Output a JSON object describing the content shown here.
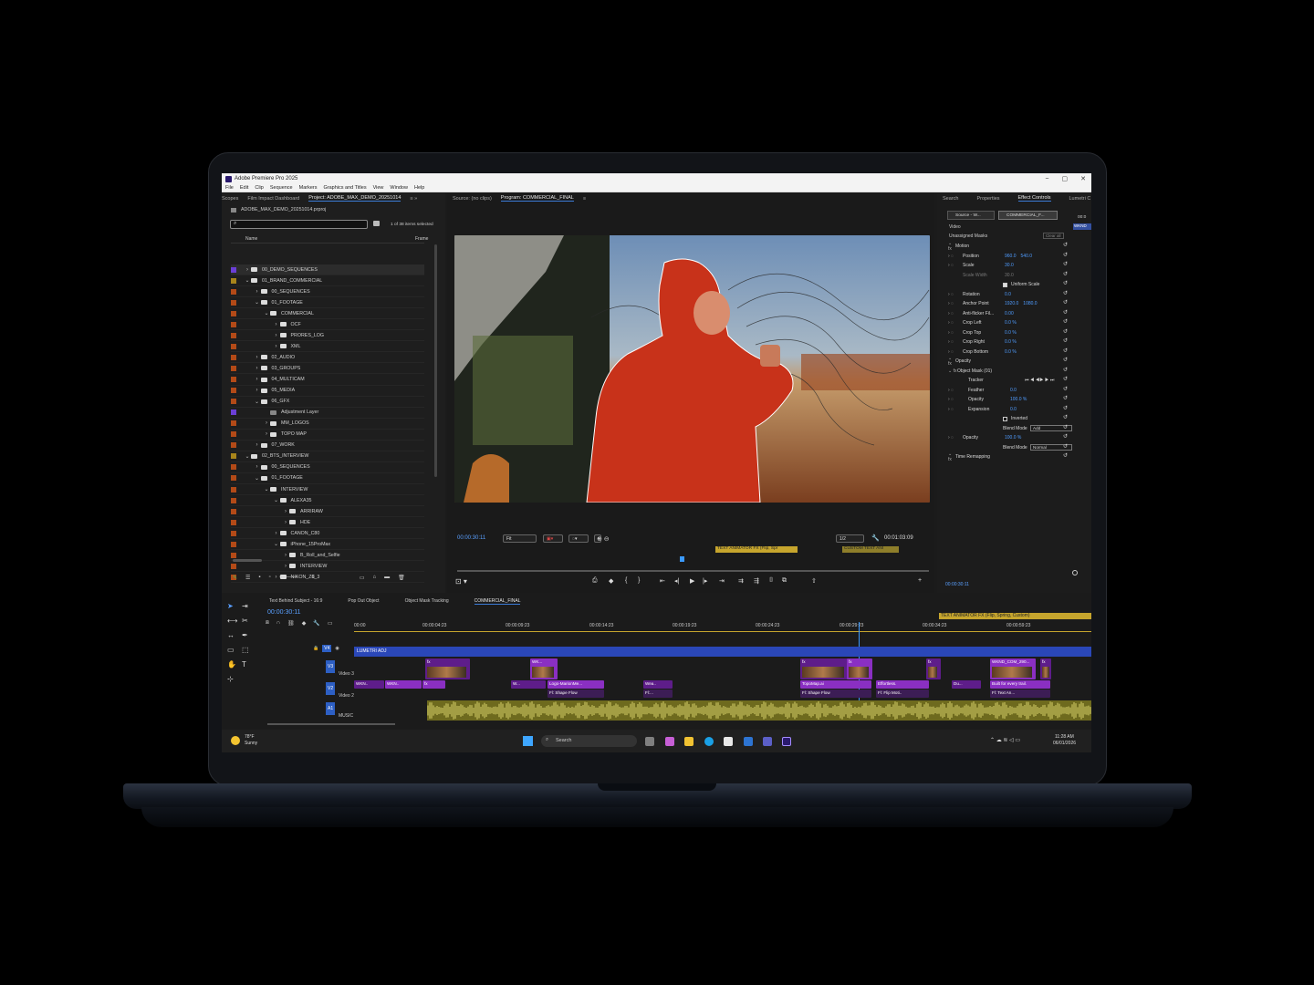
{
  "window": {
    "title": "Adobe Premiere Pro 2025",
    "minimize": "−",
    "maximize": "▢",
    "close": "✕"
  },
  "menu": [
    "File",
    "Edit",
    "Clip",
    "Sequence",
    "Markers",
    "Graphics and Titles",
    "View",
    "Window",
    "Help"
  ],
  "left_tabs": {
    "t1": "Scopes",
    "t2": "Film Impact Dashboard",
    "t3": "Project: ADOBE_MAX_DEMO_20251014"
  },
  "project": {
    "file": "ADOBE_MAX_DEMO_20251014.prproj",
    "search_placeholder": "",
    "selected": "1 of 38 items selected",
    "col_name": "Name",
    "col_frame": "Frame",
    "items": [
      {
        "name": "00_DEMO_SEQUENCES",
        "indent": 1,
        "open": false,
        "color": "#6b3fd6"
      },
      {
        "name": "01_BRAND_COMMERCIAL",
        "indent": 1,
        "open": true,
        "color": "#a8851b"
      },
      {
        "name": "00_SEQUENCES",
        "indent": 2,
        "open": false,
        "color": "#b34a17"
      },
      {
        "name": "01_FOOTAGE",
        "indent": 2,
        "open": true,
        "color": "#b34a17"
      },
      {
        "name": "COMMERCIAL",
        "indent": 3,
        "open": true,
        "color": "#b34a17"
      },
      {
        "name": "OCF",
        "indent": 4,
        "open": false,
        "color": "#b34a17"
      },
      {
        "name": "PRORES_LOG",
        "indent": 4,
        "open": false,
        "color": "#b34a17"
      },
      {
        "name": "XML",
        "indent": 4,
        "open": false,
        "color": "#b34a17"
      },
      {
        "name": "02_AUDIO",
        "indent": 2,
        "open": false,
        "color": "#b34a17"
      },
      {
        "name": "03_GROUPS",
        "indent": 2,
        "open": false,
        "color": "#b34a17"
      },
      {
        "name": "04_MULTICAM",
        "indent": 2,
        "open": false,
        "color": "#b34a17"
      },
      {
        "name": "05_MEDIA",
        "indent": 2,
        "open": false,
        "color": "#b34a17"
      },
      {
        "name": "06_GFX",
        "indent": 2,
        "open": true,
        "color": "#b34a17"
      },
      {
        "name": "Adjustment Layer",
        "indent": 3,
        "open": null,
        "color": "#6b3fd6"
      },
      {
        "name": "MM_LOGOS",
        "indent": 3,
        "open": false,
        "color": "#b34a17"
      },
      {
        "name": "TOPO MAP",
        "indent": 3,
        "open": false,
        "color": "#b34a17"
      },
      {
        "name": "07_WORK",
        "indent": 2,
        "open": false,
        "color": "#b34a17"
      },
      {
        "name": "02_BTS_INTERVIEW",
        "indent": 1,
        "open": true,
        "color": "#a8851b"
      },
      {
        "name": "00_SEQUENCES",
        "indent": 2,
        "open": false,
        "color": "#b34a17"
      },
      {
        "name": "01_FOOTAGE",
        "indent": 2,
        "open": true,
        "color": "#b34a17"
      },
      {
        "name": "INTERVIEW",
        "indent": 3,
        "open": true,
        "color": "#b34a17"
      },
      {
        "name": "ALEXA35",
        "indent": 4,
        "open": true,
        "color": "#b34a17"
      },
      {
        "name": "ARRIRAW",
        "indent": 5,
        "open": false,
        "color": "#b34a17"
      },
      {
        "name": "HDE",
        "indent": 5,
        "open": false,
        "color": "#b34a17"
      },
      {
        "name": "CANON_C80",
        "indent": 4,
        "open": false,
        "color": "#b34a17"
      },
      {
        "name": "iPhone_15ProMax",
        "indent": 4,
        "open": true,
        "color": "#b34a17"
      },
      {
        "name": "B_Roll_and_Selfie",
        "indent": 5,
        "open": false,
        "color": "#b34a17"
      },
      {
        "name": "INTERVIEW",
        "indent": 5,
        "open": false,
        "color": "#b34a17"
      },
      {
        "name": "NIKON_Z6_3",
        "indent": 4,
        "open": false,
        "color": "#b34a17"
      }
    ]
  },
  "monitor": {
    "source_tab": "Source: (no clips)",
    "program_tab": "Program: COMMERCIAL_FINAL",
    "timecode": "00:00:30:11",
    "fit": "Fit",
    "res": "1/2",
    "duration": "00:01:03:09",
    "marker1": "TEXT ANIMATOR FX (Flip, Spr",
    "marker2": "CUSTOM TEXT ANI"
  },
  "right_tabs": {
    "t1": "Search",
    "t2": "Properties",
    "t3": "Effect Controls",
    "t4": "Lumetri C"
  },
  "effect_controls": {
    "source": "Source - W...",
    "sequence": "COMMERCIAL_F...",
    "timecode_right": "00:0",
    "clip_label": "WKND",
    "section_video": "Video",
    "unassigned": "Unassigned Masks",
    "clear_all": "Clear all",
    "footer_tc": "00:00:30:11",
    "rows": [
      {
        "label": "Motion",
        "v1": "",
        "v2": "",
        "kind": "fx"
      },
      {
        "label": "Position",
        "v1": "960.0",
        "v2": "540.0",
        "kind": "prop"
      },
      {
        "label": "Scale",
        "v1": "30.0",
        "v2": "",
        "kind": "prop"
      },
      {
        "label": "Scale Width",
        "v1": "30.0",
        "v2": "",
        "kind": "dim"
      },
      {
        "label": "Uniform Scale",
        "v1": "",
        "v2": "",
        "kind": "check"
      },
      {
        "label": "Rotation",
        "v1": "0.0",
        "v2": "",
        "kind": "prop"
      },
      {
        "label": "Anchor Point",
        "v1": "1920.0",
        "v2": "1080.0",
        "kind": "prop"
      },
      {
        "label": "Anti-flicker Fil...",
        "v1": "0.00",
        "v2": "",
        "kind": "prop"
      },
      {
        "label": "Crop Left",
        "v1": "0.0 %",
        "v2": "",
        "kind": "prop"
      },
      {
        "label": "Crop Top",
        "v1": "0.0 %",
        "v2": "",
        "kind": "prop"
      },
      {
        "label": "Crop Right",
        "v1": "0.0 %",
        "v2": "",
        "kind": "prop"
      },
      {
        "label": "Crop Bottom",
        "v1": "0.0 %",
        "v2": "",
        "kind": "prop"
      },
      {
        "label": "Opacity",
        "v1": "",
        "v2": "",
        "kind": "fx"
      },
      {
        "label": "Object Mask (01)",
        "v1": "",
        "v2": "",
        "kind": "sub"
      },
      {
        "label": "Tracker",
        "v1": "",
        "v2": "",
        "kind": "tracker"
      },
      {
        "label": "Feather",
        "v1": "0.0",
        "v2": "",
        "kind": "prop2"
      },
      {
        "label": "Opacity",
        "v1": "100.0 %",
        "v2": "",
        "kind": "prop2"
      },
      {
        "label": "Expansion",
        "v1": "0.0",
        "v2": "",
        "kind": "prop2"
      },
      {
        "label": "Inverted",
        "v1": "",
        "v2": "",
        "kind": "check2"
      },
      {
        "label": "Blend Mode",
        "v1": "Add",
        "v2": "",
        "kind": "select"
      },
      {
        "label": "Opacity",
        "v1": "100.0 %",
        "v2": "",
        "kind": "prop"
      },
      {
        "label": "Blend Mode",
        "v1": "Normal",
        "v2": "",
        "kind": "select"
      },
      {
        "label": "Time Remapping",
        "v1": "",
        "v2": "",
        "kind": "fx"
      }
    ]
  },
  "timeline": {
    "tabs": [
      "Text Behind Subject - 16:9",
      "Pop Out Object",
      "Object Mask Tracking",
      "COMMERCIAL_FINAL"
    ],
    "timecode": "00:00:30:11",
    "ruler": [
      "00:00",
      "00:00:04:23",
      "00:00:09:23",
      "00:00:14:23",
      "00:00:19:23",
      "00:00:24:23",
      "00:00:29:23",
      "00:00:34:23",
      "00:00:59:23"
    ],
    "top_marker": "TEXT ANIMATOR FX (Flip, Spring, Custom)",
    "tracks": {
      "v4": "V4",
      "v3": "V3",
      "v3_name": "Video 3",
      "v2": "V2",
      "v2_name": "Video 2",
      "a1": "A1",
      "a1_name": "MUSIC"
    },
    "adj_clip": "LUMETRI ADJ",
    "clips_v3": [
      "fx",
      "WK...",
      "fx",
      "fx",
      "fx",
      "WKND_COM_290...",
      "fx"
    ],
    "clips_v2": [
      "WKN..",
      "WKN..",
      "fx",
      "W...",
      "Logo-MarionMe...",
      "Fl: Shape Flow",
      "Wea..",
      "Fl:...",
      "TopoMap.ai",
      "Fl: Shape Flow",
      "Effortless.",
      "Fl: Flip Moti..",
      "Du...",
      "Built for every trail.",
      "Fl: Text An..."
    ]
  },
  "taskbar": {
    "weather_temp": "78°F",
    "weather_desc": "Sunny",
    "search": "Search",
    "time": "11:28 AM",
    "date": "06/01/2026"
  }
}
